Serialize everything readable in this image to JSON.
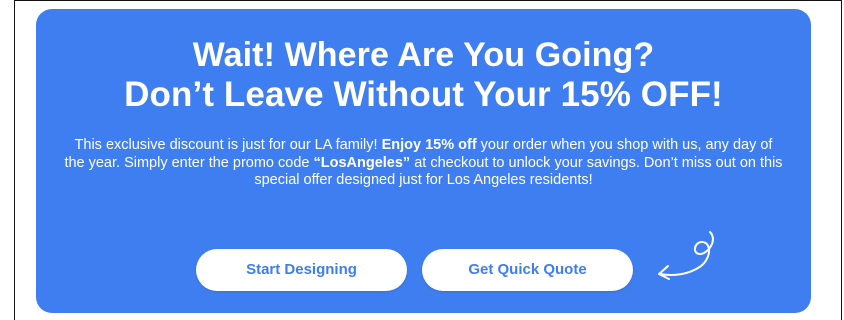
{
  "headline": {
    "line1": "Wait! Where Are You Going?",
    "line2": "Don’t Leave Without Your 15% OFF!"
  },
  "description": {
    "part1": "This exclusive discount is just for our LA family! ",
    "bold1": "Enjoy 15% off",
    "part2": " your order when you shop with us, any day of the year. Simply enter the promo code ",
    "bold2": "“LosAngeles”",
    "part3": " at checkout to unlock your savings. Don’t miss out on this special offer designed just for Los Angeles residents!"
  },
  "buttons": {
    "start_label": "Start Designing",
    "quote_label": "Get Quick Quote"
  },
  "colors": {
    "card_bg": "#3f7ef0",
    "button_text": "#3f7ef0",
    "button_bg": "#ffffff",
    "text": "#ffffff"
  },
  "icons": {
    "arrow": "curly-arrow-left-icon"
  }
}
